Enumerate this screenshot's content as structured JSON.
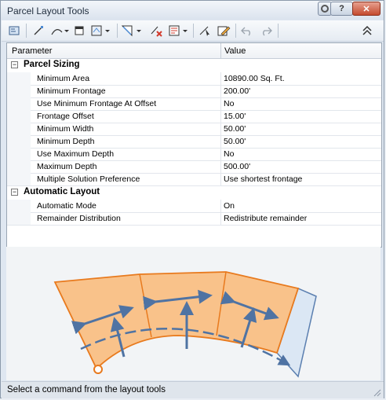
{
  "window": {
    "title": "Parcel Layout Tools"
  },
  "grid": {
    "header": {
      "parameter": "Parameter",
      "value": "Value"
    },
    "categories": [
      {
        "name": "Parcel Sizing",
        "rows": [
          {
            "param": "Minimum Area",
            "value": "10890.00 Sq. Ft."
          },
          {
            "param": "Minimum Frontage",
            "value": "200.00'"
          },
          {
            "param": "Use Minimum Frontage At Offset",
            "value": "No"
          },
          {
            "param": "Frontage Offset",
            "value": "15.00'"
          },
          {
            "param": "Minimum Width",
            "value": "50.00'"
          },
          {
            "param": "Minimum Depth",
            "value": "50.00'"
          },
          {
            "param": "Use Maximum Depth",
            "value": "No"
          },
          {
            "param": "Maximum Depth",
            "value": "500.00'"
          },
          {
            "param": "Multiple Solution Preference",
            "value": "Use shortest frontage"
          }
        ]
      },
      {
        "name": "Automatic Layout",
        "rows": [
          {
            "param": "Automatic Mode",
            "value": "On"
          },
          {
            "param": "Remainder Distribution",
            "value": "Redistribute remainder"
          }
        ]
      }
    ]
  },
  "status": {
    "text": "Select a command from the layout tools"
  },
  "colors": {
    "parcel_fill": "#f9c28a",
    "parcel_stroke": "#e87a1e",
    "arrow": "#4f73a3",
    "remainder": "#dbe7f4"
  }
}
